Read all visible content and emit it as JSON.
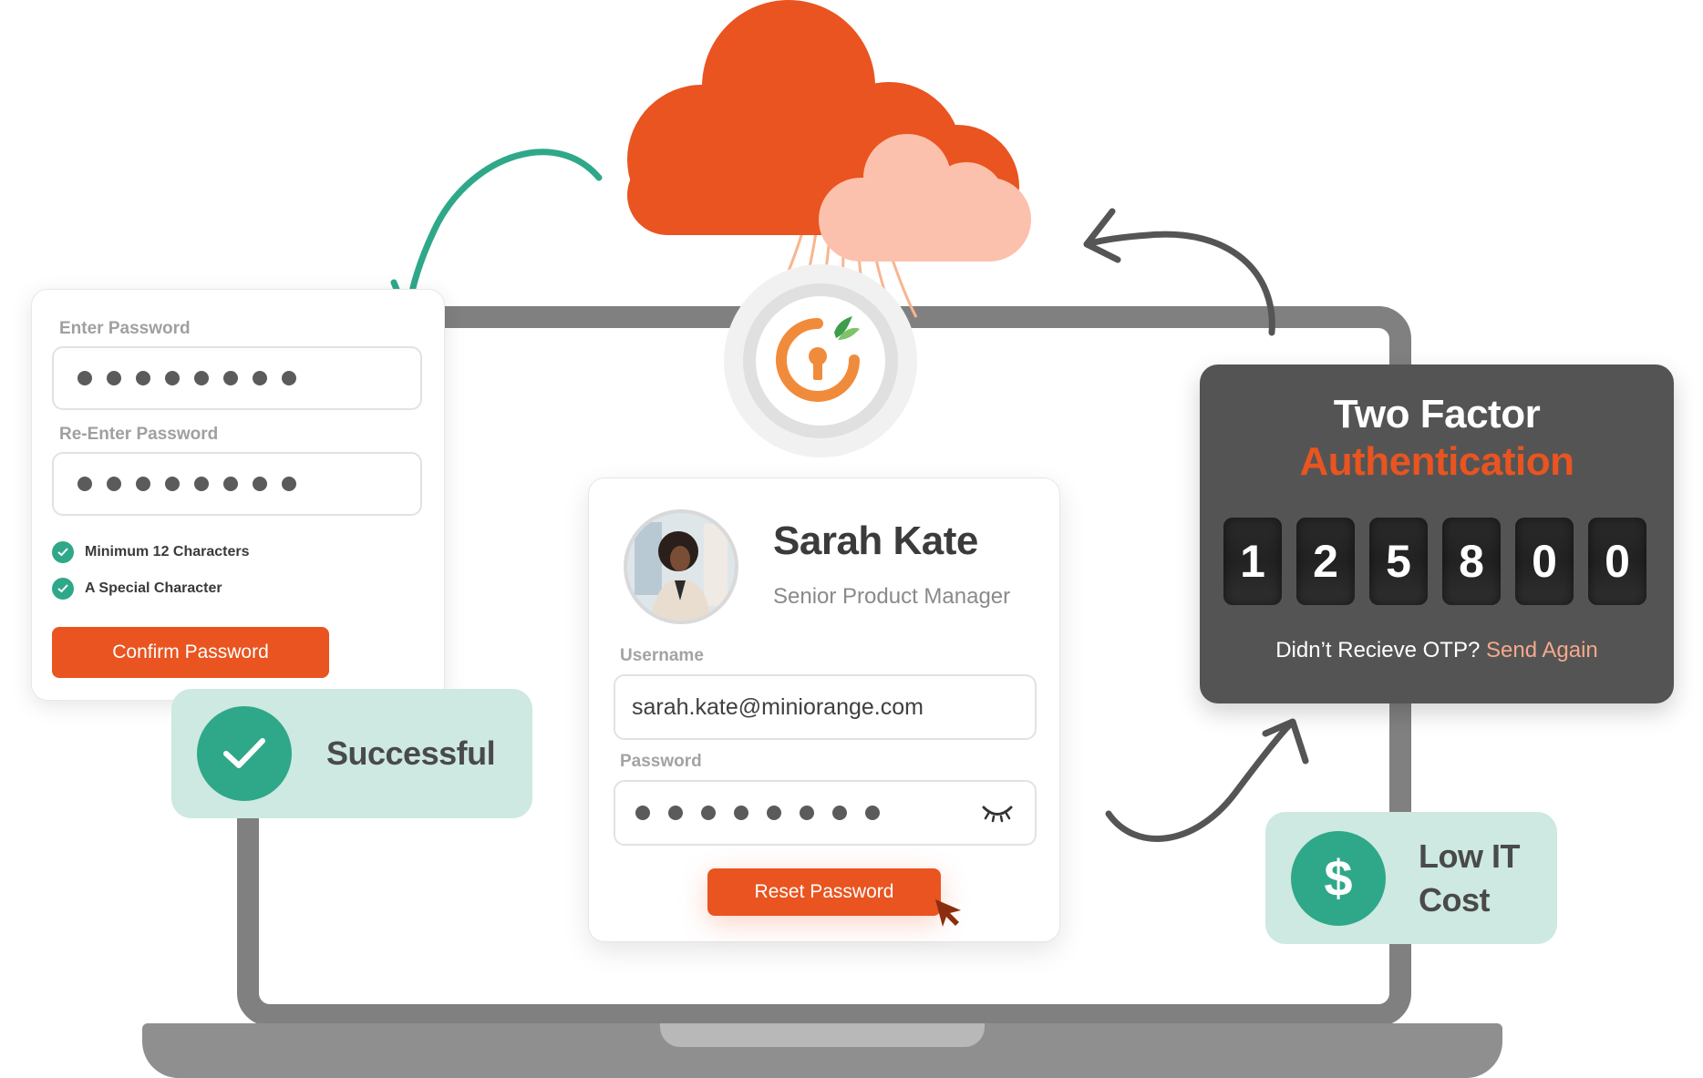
{
  "password_card": {
    "enter_label": "Enter Password",
    "reenter_label": "Re-Enter Password",
    "masked_length": 8,
    "requirements": [
      {
        "label": "Minimum 12 Characters",
        "met": true
      },
      {
        "label": "A Special Character",
        "met": true
      }
    ],
    "confirm_button": "Confirm Password"
  },
  "success_badge": {
    "label": "Successful",
    "icon": "check-icon"
  },
  "profile_card": {
    "name": "Sarah Kate",
    "role": "Senior Product Manager",
    "username_label": "Username",
    "username_value": "sarah.kate@miniorange.com",
    "password_label": "Password",
    "password_masked_length": 8,
    "password_toggle_icon": "eye-closed-icon",
    "reset_button": "Reset Password"
  },
  "two_factor": {
    "title_line1": "Two Factor",
    "title_line2": "Authentication",
    "otp_digits": [
      "1",
      "2",
      "5",
      "8",
      "0",
      "0"
    ],
    "footer_text": "Didn’t Recieve OTP?",
    "resend_link": "Send Again"
  },
  "cost_badge": {
    "line1": "Low IT",
    "line2": "Cost",
    "icon": "dollar-icon",
    "symbol": "$"
  },
  "colors": {
    "brand_orange": "#e95420",
    "light_orange": "#fcc1ac",
    "teal": "#2fa889",
    "mint": "#cde9e1",
    "dark_card": "#545454",
    "laptop_gray": "#808080",
    "link_peach": "#f5a88c"
  }
}
